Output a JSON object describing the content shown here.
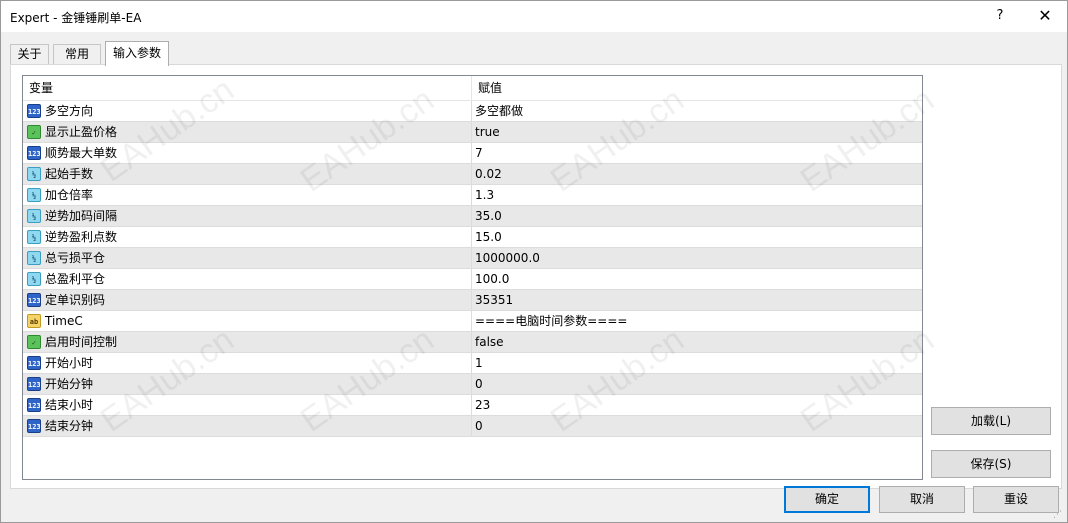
{
  "window": {
    "title": "Expert - 金锤锤刷单-EA",
    "help_glyph": "?",
    "close_glyph": "✕"
  },
  "tabs": [
    {
      "label": "关于"
    },
    {
      "label": "常用"
    },
    {
      "label": "输入参数"
    }
  ],
  "grid": {
    "col_variable": "变量",
    "col_value": "赋值",
    "rows": [
      {
        "icon": "int",
        "icon_text": "123",
        "name": "多空方向",
        "value": "多空都做"
      },
      {
        "icon": "bool",
        "icon_text": "✓",
        "name": "显示止盈价格",
        "value": "true"
      },
      {
        "icon": "int",
        "icon_text": "123",
        "name": "顺势最大单数",
        "value": "7"
      },
      {
        "icon": "dbl",
        "icon_text": "½",
        "name": "起始手数",
        "value": "0.02"
      },
      {
        "icon": "dbl",
        "icon_text": "½",
        "name": "加仓倍率",
        "value": "1.3"
      },
      {
        "icon": "dbl",
        "icon_text": "½",
        "name": "逆势加码间隔",
        "value": "35.0"
      },
      {
        "icon": "dbl",
        "icon_text": "½",
        "name": "逆势盈利点数",
        "value": "15.0"
      },
      {
        "icon": "dbl",
        "icon_text": "½",
        "name": "总亏损平仓",
        "value": "1000000.0"
      },
      {
        "icon": "dbl",
        "icon_text": "½",
        "name": "总盈利平仓",
        "value": "100.0"
      },
      {
        "icon": "int",
        "icon_text": "123",
        "name": "定单识别码",
        "value": "35351"
      },
      {
        "icon": "str",
        "icon_text": "ab",
        "name": "TimeC",
        "value": "====电脑时间参数===="
      },
      {
        "icon": "bool",
        "icon_text": "✓",
        "name": "启用时间控制",
        "value": "false"
      },
      {
        "icon": "int",
        "icon_text": "123",
        "name": "开始小时",
        "value": "1"
      },
      {
        "icon": "int",
        "icon_text": "123",
        "name": "开始分钟",
        "value": "0"
      },
      {
        "icon": "int",
        "icon_text": "123",
        "name": "结束小时",
        "value": "23"
      },
      {
        "icon": "int",
        "icon_text": "123",
        "name": "结束分钟",
        "value": "0"
      }
    ]
  },
  "buttons": {
    "load": "加载(L)",
    "save": "保存(S)",
    "ok": "确定",
    "cancel": "取消",
    "reset": "重设"
  },
  "watermark": "EAHub.cn"
}
